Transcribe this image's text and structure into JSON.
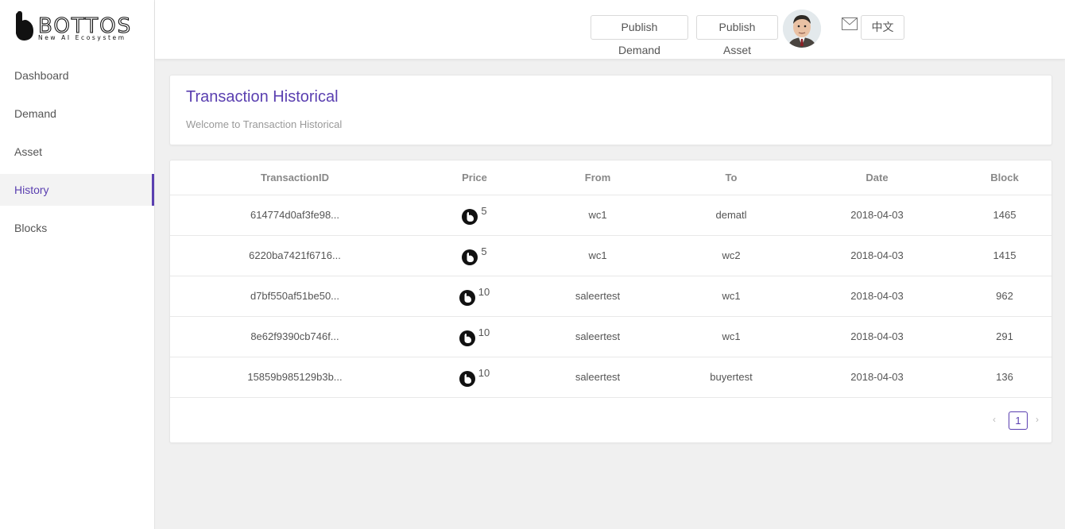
{
  "brand": {
    "name": "BOTTOS",
    "tagline": "New AI Ecosystem"
  },
  "sidebar": {
    "items": [
      {
        "label": "Dashboard",
        "active": false
      },
      {
        "label": "Demand",
        "active": false
      },
      {
        "label": "Asset",
        "active": false
      },
      {
        "label": "History",
        "active": true
      },
      {
        "label": "Blocks",
        "active": false
      }
    ]
  },
  "header": {
    "publish_demand": "Publish Demand",
    "publish_asset": "Publish Asset",
    "language": "中文"
  },
  "page": {
    "title": "Transaction Historical",
    "subtitle": "Welcome to Transaction Historical"
  },
  "table": {
    "headers": [
      "TransactionID",
      "Price",
      "From",
      "To",
      "Date",
      "Block"
    ],
    "rows": [
      {
        "id": "614774d0af3fe98...",
        "price": "5",
        "from": "wc1",
        "to": "dematl",
        "date": "2018-04-03",
        "block": "1465"
      },
      {
        "id": "6220ba7421f6716...",
        "price": "5",
        "from": "wc1",
        "to": "wc2",
        "date": "2018-04-03",
        "block": "1415"
      },
      {
        "id": "d7bf550af51be50...",
        "price": "10",
        "from": "saleertest",
        "to": "wc1",
        "date": "2018-04-03",
        "block": "962"
      },
      {
        "id": "8e62f9390cb746f...",
        "price": "10",
        "from": "saleertest",
        "to": "wc1",
        "date": "2018-04-03",
        "block": "291"
      },
      {
        "id": "15859b985129b3b...",
        "price": "10",
        "from": "saleertest",
        "to": "buyertest",
        "date": "2018-04-03",
        "block": "136"
      }
    ]
  },
  "pagination": {
    "current": "1",
    "prev": "‹",
    "next": "›"
  },
  "colors": {
    "accent": "#5a3fb0",
    "background": "#f0f0f0"
  }
}
